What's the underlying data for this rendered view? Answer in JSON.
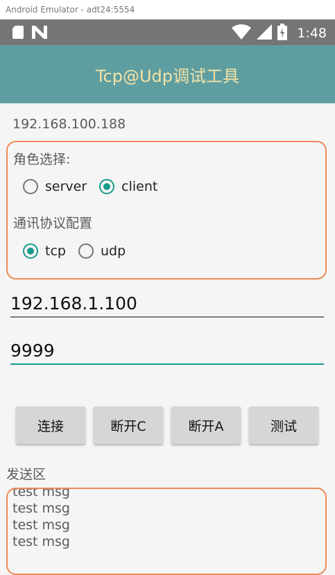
{
  "window": {
    "title": "Android Emulator - adt24:5554"
  },
  "status_bar": {
    "time": "1:48",
    "left_icons": [
      "sd-card-icon",
      "n-logo-icon"
    ],
    "right_icons": [
      "wifi-icon",
      "signal-icon",
      "battery-icon"
    ]
  },
  "app_bar": {
    "title": "Tcp@Udp调试工具",
    "color": "#5f9ea0",
    "text_color": "#f4e3a6"
  },
  "local_ip": "192.168.100.188",
  "role": {
    "label": "角色选择:",
    "options": [
      {
        "label": "server",
        "checked": false
      },
      {
        "label": "client",
        "checked": true
      }
    ]
  },
  "protocol": {
    "label": "通讯协议配置",
    "options": [
      {
        "label": "tcp",
        "checked": true
      },
      {
        "label": "udp",
        "checked": false
      }
    ]
  },
  "inputs": {
    "ip_value": "192.168.1.100",
    "port_value": "9999"
  },
  "buttons": {
    "connect": "连接",
    "disconnect_c": "断开C",
    "disconnect_a": "断开A",
    "test": "测试"
  },
  "send_area": {
    "label": "发送区",
    "lines": [
      "test msg",
      "test msg",
      "test msg",
      "test msg"
    ]
  },
  "colors": {
    "accent": "#169a8c",
    "border": "#ef8a55"
  }
}
